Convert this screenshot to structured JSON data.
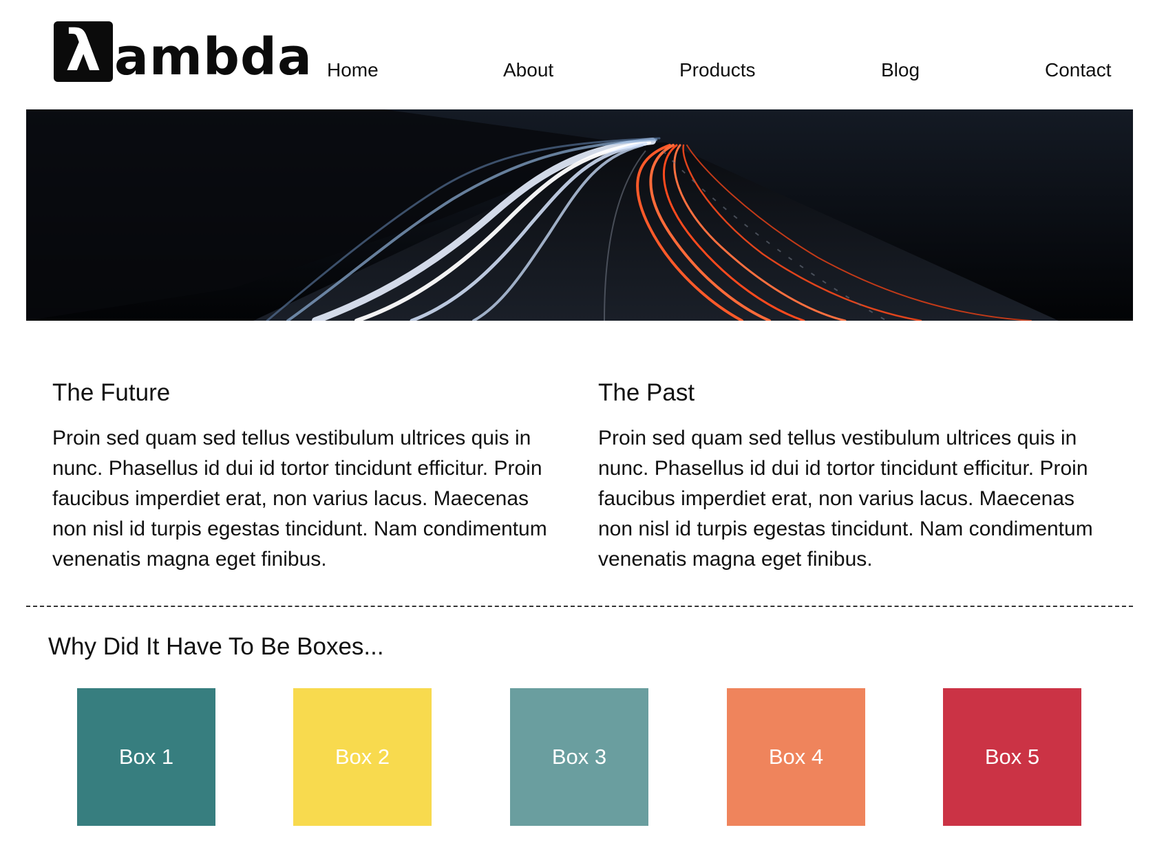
{
  "header": {
    "logo": {
      "mark": "λ",
      "text": "ambda"
    },
    "nav": [
      {
        "label": "Home"
      },
      {
        "label": "About"
      },
      {
        "label": "Products"
      },
      {
        "label": "Blog"
      },
      {
        "label": "Contact"
      }
    ]
  },
  "hero": {
    "image": "highway-light-trails-night"
  },
  "columns": [
    {
      "title": "The Future",
      "body": "Proin sed quam sed tellus vestibulum ultrices quis in nunc. Phasellus id dui id tortor tincidunt efficitur. Proin faucibus imperdiet erat, non varius lacus. Maecenas non nisl id turpis egestas tincidunt. Nam condimentum venenatis magna eget finibus."
    },
    {
      "title": "The Past",
      "body": "Proin sed quam sed tellus vestibulum ultrices quis in nunc. Phasellus id dui id tortor tincidunt efficitur. Proin faucibus imperdiet erat, non varius lacus. Maecenas non nisl id turpis egestas tincidunt. Nam condimentum venenatis magna eget finibus."
    }
  ],
  "boxes_section": {
    "title": "Why Did It Have To Be Boxes...",
    "boxes": [
      {
        "label": "Box 1",
        "color": "#377E7F"
      },
      {
        "label": "Box 2",
        "color": "#F8DA4E"
      },
      {
        "label": "Box 3",
        "color": "#6A9E9F"
      },
      {
        "label": "Box 4",
        "color": "#EF845C"
      },
      {
        "label": "Box 5",
        "color": "#CB3345"
      }
    ]
  }
}
